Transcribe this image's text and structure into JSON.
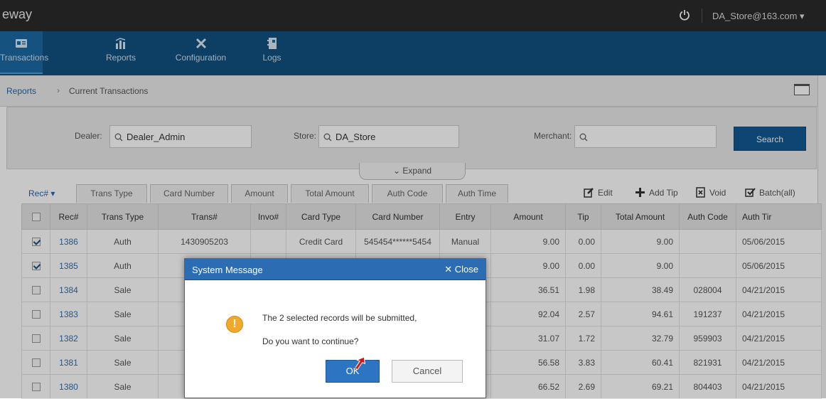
{
  "brand": "eway",
  "user": "DA_Store@163.com",
  "nav": [
    {
      "label": "Transactions",
      "icon": "id-card-icon"
    },
    {
      "label": "Reports",
      "icon": "bar-chart-icon"
    },
    {
      "label": "Configuration",
      "icon": "tools-icon"
    },
    {
      "label": "Logs",
      "icon": "notebook-icon"
    }
  ],
  "breadcrumb": {
    "root": "Reports",
    "sep": "›",
    "current": "Current Transactions"
  },
  "filter": {
    "dealer_label": "Dealer:",
    "dealer_value": "Dealer_Admin",
    "store_label": "Store:",
    "store_value": "DA_Store",
    "merchant_label": "Merchant:",
    "merchant_value": "",
    "search_label": "Search",
    "expand_label": "Expand"
  },
  "column_tabs": {
    "rec": "Rec#",
    "items": [
      "Trans Type",
      "Card Number",
      "Amount",
      "Total Amount",
      "Auth Code",
      "Auth Time"
    ]
  },
  "actions": {
    "edit": "Edit",
    "add_tip": "Add Tip",
    "void": "Void",
    "batch": "Batch(all)"
  },
  "table": {
    "headers": [
      "",
      "Rec#",
      "Trans Type",
      "Trans#",
      "Invo#",
      "Card Type",
      "Card Number",
      "Entry",
      "Amount",
      "Tip",
      "Total Amount",
      "Auth Code",
      "Auth Tir"
    ],
    "rows": [
      {
        "checked": true,
        "rec": "1386",
        "type": "Auth",
        "trans": "1430905203",
        "invo": "",
        "card_type": "Credit Card",
        "card": "545454******5454",
        "entry": "Manual",
        "amount": "9.00",
        "tip": "0.00",
        "total": "9.00",
        "auth": "",
        "time": "05/06/2015"
      },
      {
        "checked": true,
        "rec": "1385",
        "type": "Auth",
        "trans": "",
        "invo": "",
        "card_type": "",
        "card": "",
        "entry": "nual",
        "amount": "9.00",
        "tip": "0.00",
        "total": "9.00",
        "auth": "",
        "time": "05/06/2015"
      },
      {
        "checked": false,
        "rec": "1384",
        "type": "Sale",
        "trans": "",
        "invo": "",
        "card_type": "",
        "card": "",
        "entry": "nual",
        "amount": "36.51",
        "tip": "1.98",
        "total": "38.49",
        "auth": "028004",
        "time": "04/21/2015"
      },
      {
        "checked": false,
        "rec": "1383",
        "type": "Sale",
        "trans": "",
        "invo": "",
        "card_type": "",
        "card": "",
        "entry": "nual",
        "amount": "92.04",
        "tip": "2.57",
        "total": "94.61",
        "auth": "191237",
        "time": "04/21/2015"
      },
      {
        "checked": false,
        "rec": "1382",
        "type": "Sale",
        "trans": "",
        "invo": "",
        "card_type": "",
        "card": "",
        "entry": "nual",
        "amount": "31.07",
        "tip": "1.72",
        "total": "32.79",
        "auth": "959903",
        "time": "04/21/2015"
      },
      {
        "checked": false,
        "rec": "1381",
        "type": "Sale",
        "trans": "",
        "invo": "",
        "card_type": "",
        "card": "",
        "entry": "nual",
        "amount": "56.58",
        "tip": "3.83",
        "total": "60.41",
        "auth": "821931",
        "time": "04/21/2015"
      },
      {
        "checked": false,
        "rec": "1380",
        "type": "Sale",
        "trans": "",
        "invo": "",
        "card_type": "",
        "card": "",
        "entry": "nual",
        "amount": "66.52",
        "tip": "2.69",
        "total": "69.21",
        "auth": "804403",
        "time": "04/21/2015"
      }
    ]
  },
  "dialog": {
    "title": "System Message",
    "close": "✕ Close",
    "message1": "The 2 selected records will be submitted,",
    "message2": "Do you want to continue?",
    "ok": "OK",
    "cancel": "Cancel"
  },
  "colors": {
    "nav": "#115182",
    "accent": "#2b6cb3",
    "link": "#2f70b3",
    "warning": "#f0a92a"
  }
}
